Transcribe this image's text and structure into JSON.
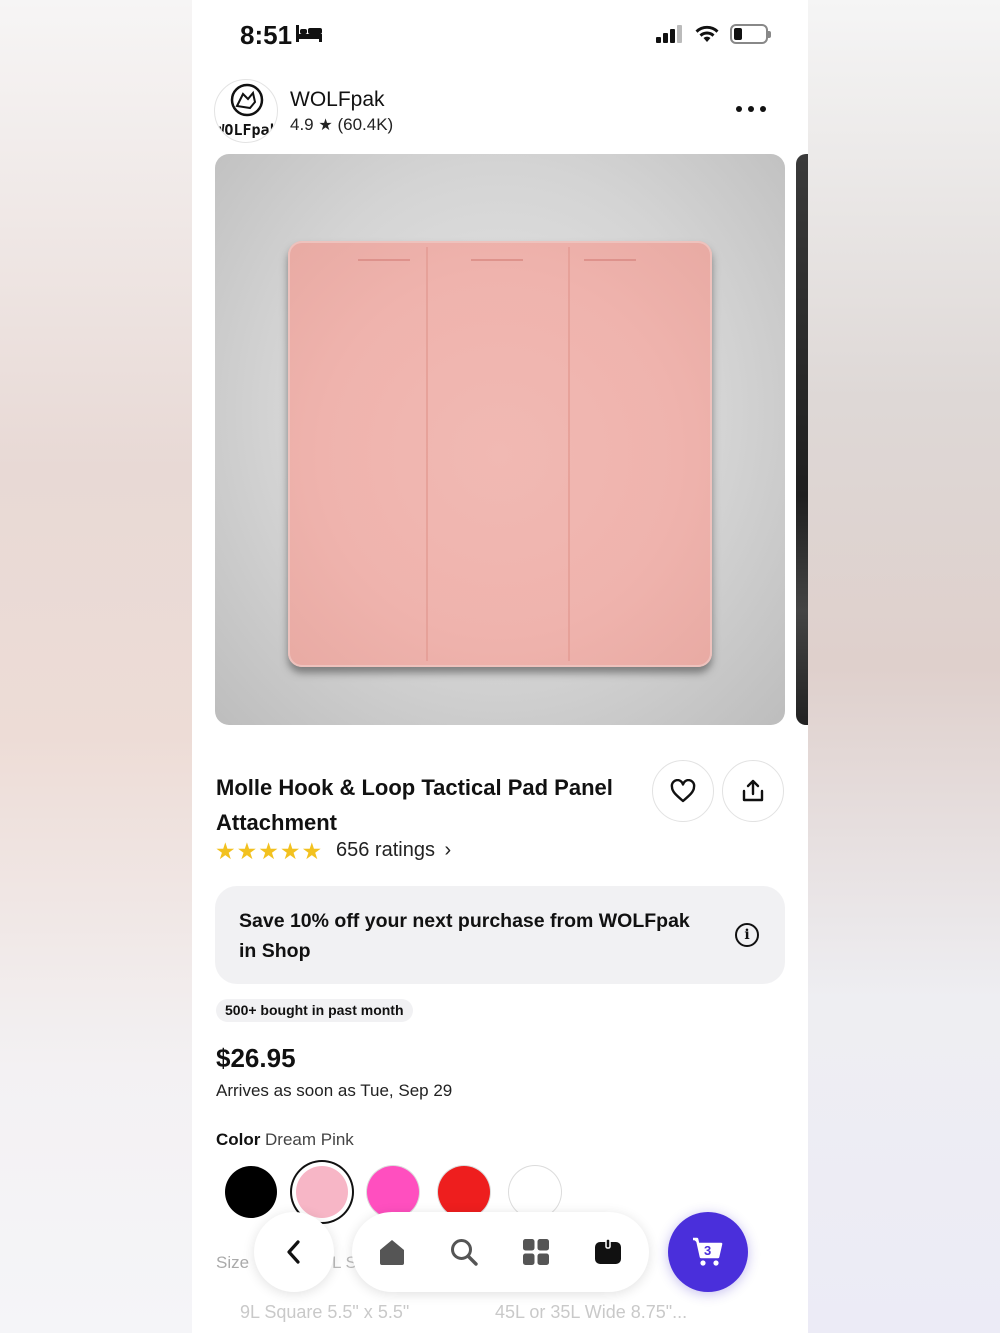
{
  "status_bar": {
    "time": "8:51"
  },
  "shop": {
    "name": "WOLFpak",
    "logo_text": "WOLFpak",
    "rating": "4.9",
    "review_count": "(60.4K)"
  },
  "product": {
    "title": "Molle Hook & Loop Tactical Pad Panel Attachment",
    "ratings_label": "656 ratings",
    "stars": 5
  },
  "promo": {
    "text": "Save 10% off your next purchase from WOLFpak in Shop"
  },
  "badge": "500+ bought in past month",
  "price": "$26.95",
  "delivery": "Arrives as soon as Tue, Sep 29",
  "color": {
    "label": "Color",
    "selected": "Dream Pink",
    "swatches": [
      {
        "name": "black",
        "hex": "#000000"
      },
      {
        "name": "dream-pink",
        "hex": "#f7b6c6"
      },
      {
        "name": "hot-pink",
        "hex": "#ff4fbf"
      },
      {
        "name": "red",
        "hex": "#ee1e1e"
      },
      {
        "name": "white",
        "hex": "#ffffff"
      }
    ]
  },
  "size": {
    "label": "Size",
    "peek": "L S",
    "options": [
      "9L Square 5.5\" x 5.5\"",
      "45L or 35L Wide 8.75\"..."
    ]
  },
  "cart": {
    "count": "3"
  },
  "icons": {
    "sleep": "bed-icon",
    "signal": "cellular-signal-icon",
    "wifi": "wifi-icon",
    "battery": "battery-icon",
    "more": "more-horizontal-icon",
    "favorite": "heart-icon",
    "share": "share-icon",
    "info": "info-icon",
    "back": "chevron-left-icon",
    "home": "home-icon",
    "search": "search-icon",
    "categories": "grid-icon",
    "orders": "bag-icon",
    "cart": "cart-icon"
  }
}
